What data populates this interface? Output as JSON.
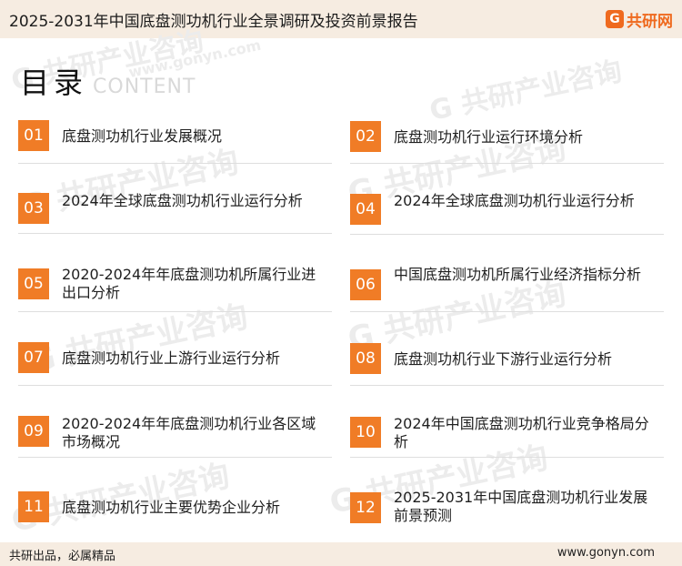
{
  "header": {
    "title": "2025-2031年中国底盘测功机行业全景调研及投资前景报告"
  },
  "logo": {
    "mark": "G",
    "text": "共研网"
  },
  "toc": {
    "title": "目录",
    "subtitle": "CONTENT",
    "items": [
      {
        "num": "01",
        "label": "底盘测功机行业发展概况"
      },
      {
        "num": "02",
        "label": "底盘测功机行业运行环境分析"
      },
      {
        "num": "03",
        "label": "2024年全球底盘测功机行业运行分析"
      },
      {
        "num": "04",
        "label": "2024年全球底盘测功机行业运行分析"
      },
      {
        "num": "05",
        "label": "2020-2024年年底盘测功机所属行业进出口分析"
      },
      {
        "num": "06",
        "label": "中国底盘测功机所属行业经济指标分析"
      },
      {
        "num": "07",
        "label": "底盘测功机行业上游行业运行分析"
      },
      {
        "num": "08",
        "label": "底盘测功机行业下游行业运行分析"
      },
      {
        "num": "09",
        "label": "2020-2024年年底盘测功机行业各区域市场概况"
      },
      {
        "num": "10",
        "label": "2024年中国底盘测功机行业竞争格局分析"
      },
      {
        "num": "11",
        "label": "底盘测功机行业主要优势企业分析"
      },
      {
        "num": "12",
        "label": "2025-2031年中国底盘测功机行业发展前景预测"
      }
    ]
  },
  "watermark": {
    "text": "G 共研产业咨询",
    "url_text": "www.gonyn.com"
  },
  "footer": {
    "left": "共研出品，必属精品",
    "right": "www.gonyn.com"
  },
  "colors": {
    "accent": "#f07c26",
    "band": "#f6ece1"
  }
}
